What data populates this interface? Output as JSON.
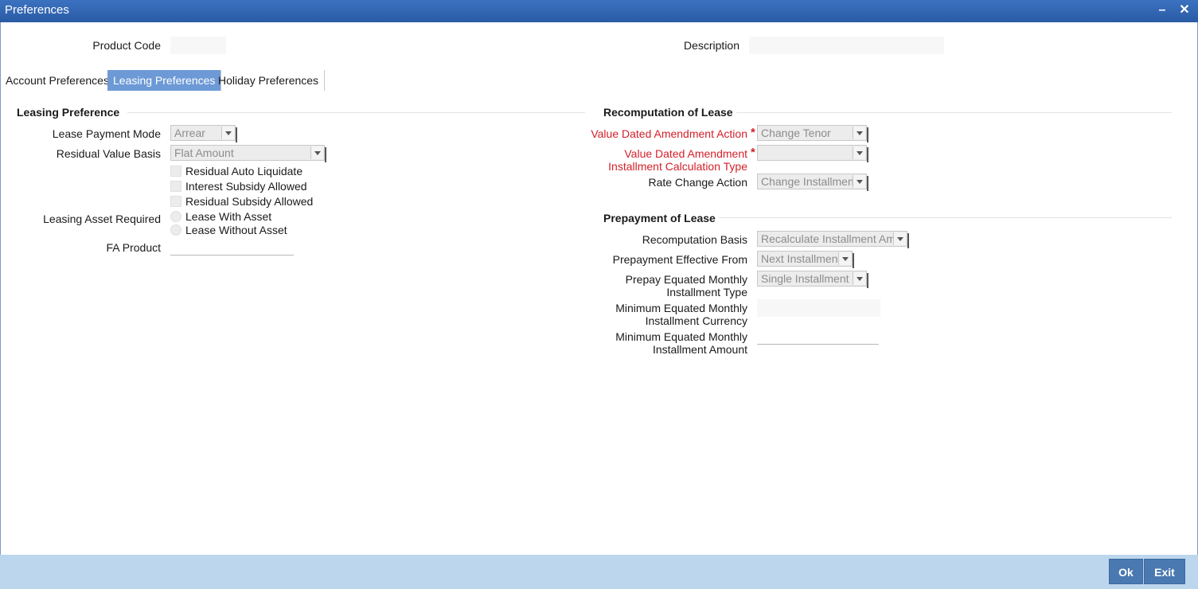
{
  "window": {
    "title": "Preferences",
    "minimize_glyph": "–",
    "close_glyph": "✕"
  },
  "header": {
    "product_code_label": "Product Code",
    "product_code_value": "",
    "description_label": "Description",
    "description_value": ""
  },
  "tabs": [
    {
      "label": "Account Preferences",
      "active": false
    },
    {
      "label": "Leasing Preferences",
      "active": true
    },
    {
      "label": "Holiday Preferences",
      "active": false
    }
  ],
  "leasing_preference": {
    "title": "Leasing Preference",
    "lease_payment_mode_label": "Lease Payment Mode",
    "lease_payment_mode_value": "Arrear",
    "residual_value_basis_label": "Residual Value Basis",
    "residual_value_basis_value": "Flat Amount",
    "residual_auto_liquidate_label": "Residual Auto Liquidate",
    "interest_subsidy_allowed_label": "Interest Subsidy Allowed",
    "residual_subsidy_allowed_label": "Residual Subsidy Allowed",
    "leasing_asset_required_label": "Leasing Asset Required",
    "lease_with_asset_label": "Lease With Asset",
    "lease_without_asset_label": "Lease Without Asset",
    "fa_product_label": "FA Product",
    "fa_product_value": ""
  },
  "recomputation": {
    "title": "Recomputation of Lease",
    "value_dated_action_label": "Value Dated Amendment Action",
    "value_dated_action_value": "Change Tenor",
    "value_dated_calc_label_1": "Value Dated Amendment",
    "value_dated_calc_label_2": "Installment Calculation Type",
    "value_dated_calc_value": "",
    "rate_change_action_label": "Rate Change Action",
    "rate_change_action_value": "Change Installment",
    "required_mark": "*"
  },
  "prepayment": {
    "title": "Prepayment of Lease",
    "recomputation_basis_label": "Recomputation Basis",
    "recomputation_basis_value": "Recalculate Installment Amt",
    "effective_from_label": "Prepayment Effective From",
    "effective_from_value": "Next Installment",
    "emi_type_label_1": "Prepay Equated Monthly",
    "emi_type_label_2": "Installment Type",
    "emi_type_value": "Single Installment",
    "min_emi_currency_label_1": "Minimum Equated Monthly",
    "min_emi_currency_label_2": "Installment Currency",
    "min_emi_currency_value": "",
    "min_emi_amount_label_1": "Minimum Equated Monthly",
    "min_emi_amount_label_2": "Installment Amount",
    "min_emi_amount_value": ""
  },
  "footer": {
    "ok_label": "Ok",
    "exit_label": "Exit"
  },
  "colors": {
    "titlebar": "#2f63ad",
    "active_tab": "#6d9ad6",
    "required_text": "#d4202a",
    "footer_bg": "#bcd6ee",
    "button_bg": "#4a78b0"
  }
}
